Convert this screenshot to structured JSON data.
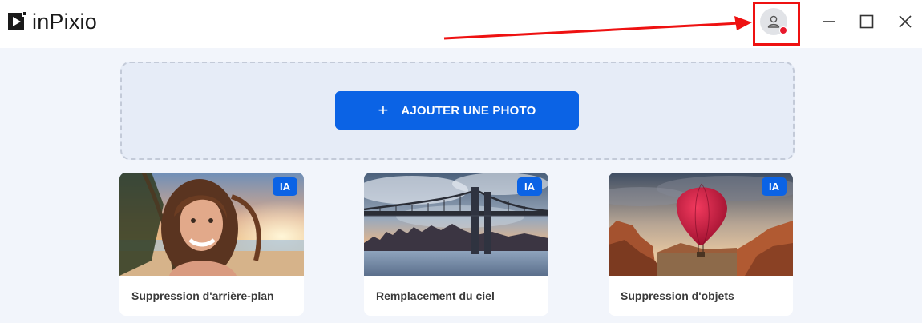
{
  "app": {
    "name": "inPixio"
  },
  "icons": {
    "logo": "play-logo-icon",
    "account": "user-icon",
    "minimize": "minimize-icon",
    "maximize": "maximize-icon",
    "close": "close-icon",
    "plus": "plus-icon"
  },
  "colors": {
    "accent": "#0b63e5",
    "notification": "#e8192c",
    "annotation": "#ee1111",
    "background": "#f2f5fb"
  },
  "dropzone": {
    "plus": "+",
    "button_label": "AJOUTER UNE PHOTO"
  },
  "cards": [
    {
      "badge": "IA",
      "label": "Suppression d'arrière-plan"
    },
    {
      "badge": "IA",
      "label": "Remplacement du ciel"
    },
    {
      "badge": "IA",
      "label": "Suppression d'objets"
    }
  ]
}
